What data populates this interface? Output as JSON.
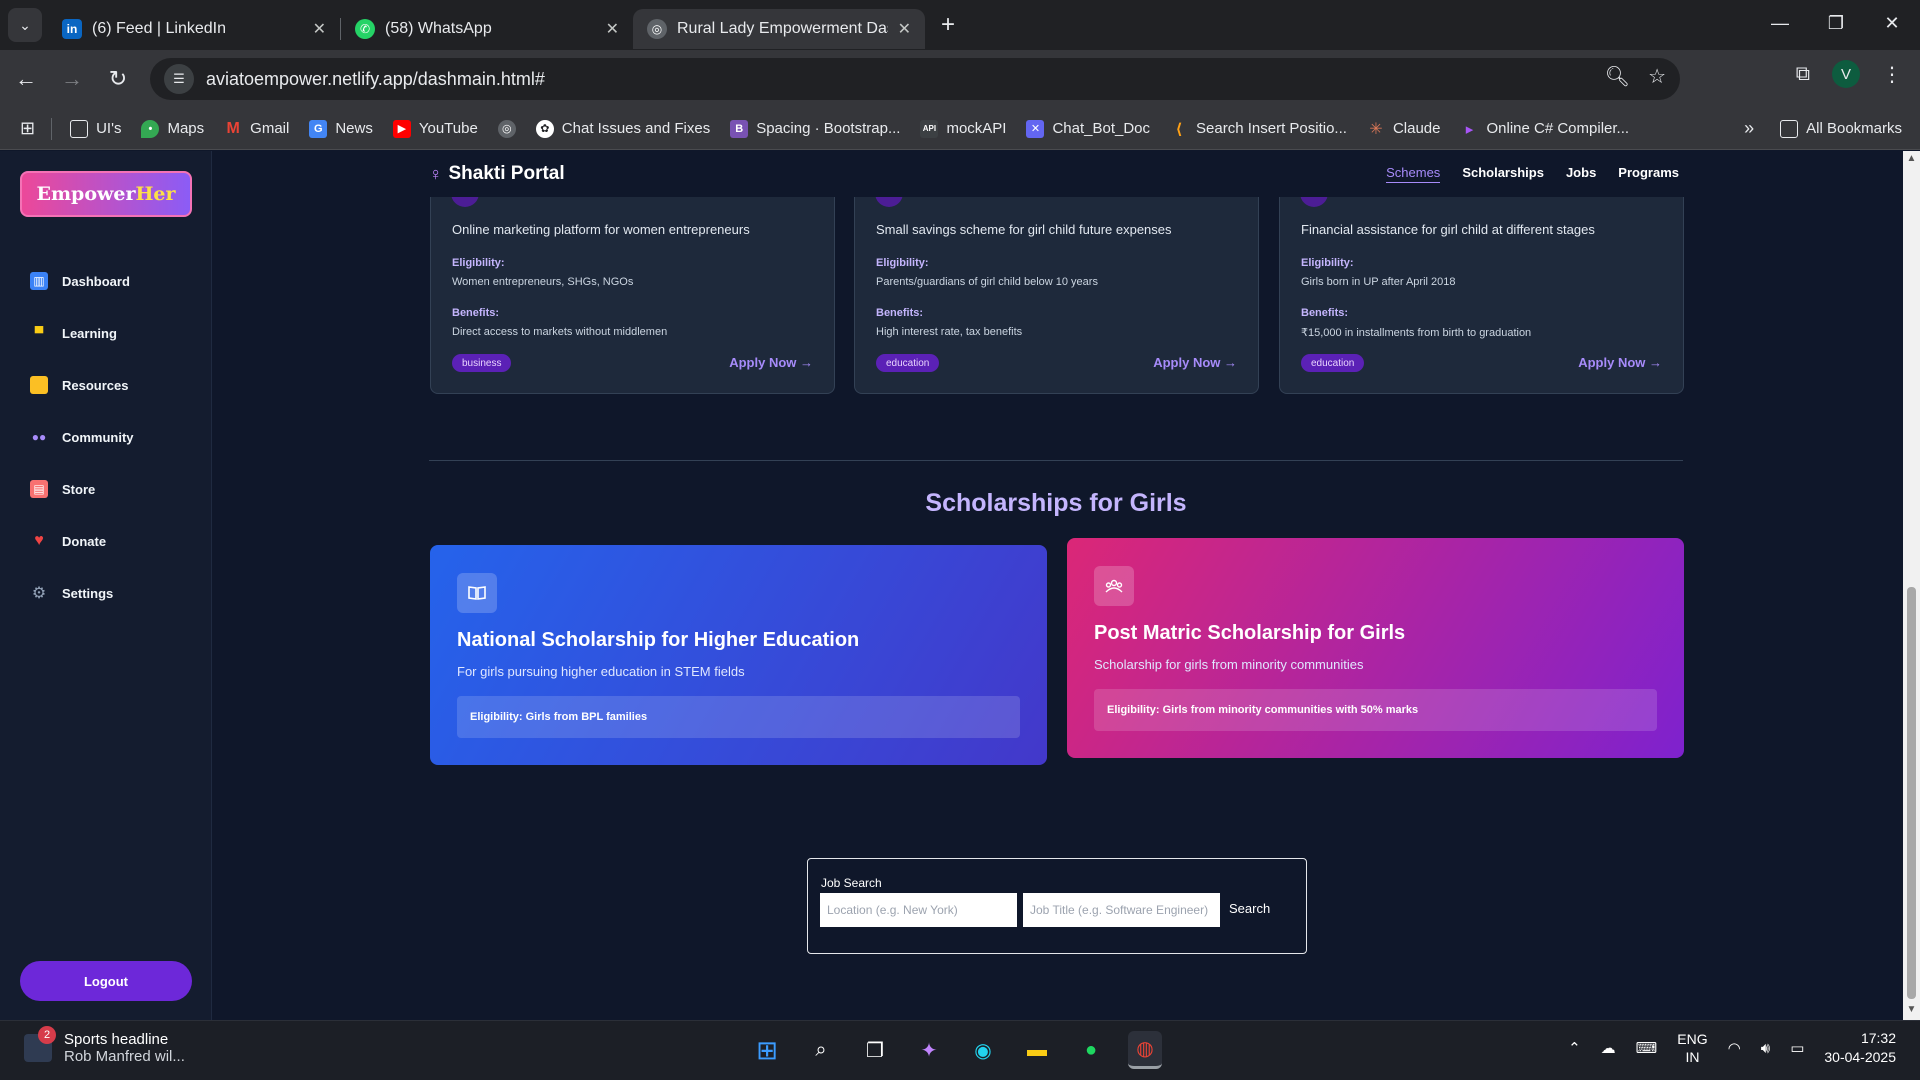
{
  "browser": {
    "tabs": [
      {
        "title": "(6) Feed | LinkedIn",
        "icon": "linkedin-icon"
      },
      {
        "title": "(58) WhatsApp",
        "icon": "whatsapp-icon"
      },
      {
        "title": "Rural Lady Empowerment Dashboard",
        "icon": "globe-icon",
        "active": true
      }
    ],
    "url": "aviatoempower.netlify.app/dashmain.html#",
    "profile_initial": "V",
    "bookmarks": [
      {
        "label": "UI's",
        "icon": "folder-icon"
      },
      {
        "label": "Maps",
        "icon": "maps-icon"
      },
      {
        "label": "Gmail",
        "icon": "gmail-icon"
      },
      {
        "label": "News",
        "icon": "news-icon"
      },
      {
        "label": "YouTube",
        "icon": "youtube-icon"
      },
      {
        "label": "",
        "icon": "globe-icon"
      },
      {
        "label": "Chat Issues and Fixes",
        "icon": "openai-icon"
      },
      {
        "label": "Spacing · Bootstrap...",
        "icon": "bootstrap-icon"
      },
      {
        "label": "mockAPI",
        "icon": "mockapi-icon"
      },
      {
        "label": "Chat_Bot_Doc",
        "icon": "doc-icon"
      },
      {
        "label": "Search Insert Positio...",
        "icon": "leetcode-icon"
      },
      {
        "label": "Claude",
        "icon": "claude-icon"
      },
      {
        "label": "Online C# Compiler...",
        "icon": "compiler-icon"
      }
    ],
    "all_bookmarks": "All Bookmarks"
  },
  "sidebar": {
    "logo_a": "Empower",
    "logo_b": "Her",
    "items": [
      {
        "label": "Dashboard",
        "icon": "chart-icon",
        "color": "#60a5fa"
      },
      {
        "label": "Learning",
        "icon": "graduation-icon",
        "color": "#facc15"
      },
      {
        "label": "Resources",
        "icon": "folder-icon",
        "color": "#fbbf24"
      },
      {
        "label": "Community",
        "icon": "people-icon",
        "color": "#a78bfa"
      },
      {
        "label": "Store",
        "icon": "store-icon",
        "color": "#f87171"
      },
      {
        "label": "Donate",
        "icon": "heart-icon",
        "color": "#ef4444"
      },
      {
        "label": "Settings",
        "icon": "gear-icon",
        "color": "#94a3b8"
      }
    ],
    "logout": "Logout"
  },
  "topnav": {
    "title": "Shakti Portal",
    "links": [
      "Schemes",
      "Scholarships",
      "Jobs",
      "Programs"
    ],
    "active": "Schemes"
  },
  "schemes": [
    {
      "desc": "Online marketing platform for women entrepreneurs",
      "eligibility_label": "Eligibility:",
      "eligibility": "Women entrepreneurs, SHGs, NGOs",
      "benefits_label": "Benefits:",
      "benefits": "Direct access to markets without middlemen",
      "tag": "business",
      "apply": "Apply Now →"
    },
    {
      "desc": "Small savings scheme for girl child future expenses",
      "eligibility_label": "Eligibility:",
      "eligibility": "Parents/guardians of girl child below 10 years",
      "benefits_label": "Benefits:",
      "benefits": "High interest rate, tax benefits",
      "tag": "education",
      "apply": "Apply Now →"
    },
    {
      "desc": "Financial assistance for girl child at different stages",
      "eligibility_label": "Eligibility:",
      "eligibility": "Girls born in UP after April 2018",
      "benefits_label": "Benefits:",
      "benefits": "₹15,000 in installments from birth to graduation",
      "tag": "education",
      "apply": "Apply Now →"
    }
  ],
  "scholarships_title": "Scholarships for Girls",
  "scholarships": [
    {
      "title": "National Scholarship for Higher Education",
      "desc": "For girls pursuing higher education in STEM fields",
      "eligibility": "Eligibility: Girls from BPL families",
      "icon": "book-icon"
    },
    {
      "title": "Post Matric Scholarship for Girls",
      "desc": "Scholarship for girls from minority communities",
      "eligibility": "Eligibility: Girls from minority communities with 50% marks",
      "icon": "group-icon"
    }
  ],
  "job_search": {
    "label": "Job Search",
    "location_placeholder": "Location (e.g. New York)",
    "title_placeholder": "Job Title (e.g. Software Engineer)",
    "button": "Search"
  },
  "taskbar": {
    "notification_count": "2",
    "news_headline": "Sports headline",
    "news_sub": "Rob Manfred wil...",
    "lang_a": "ENG",
    "lang_b": "IN",
    "time": "17:32",
    "date": "30-04-2025"
  }
}
